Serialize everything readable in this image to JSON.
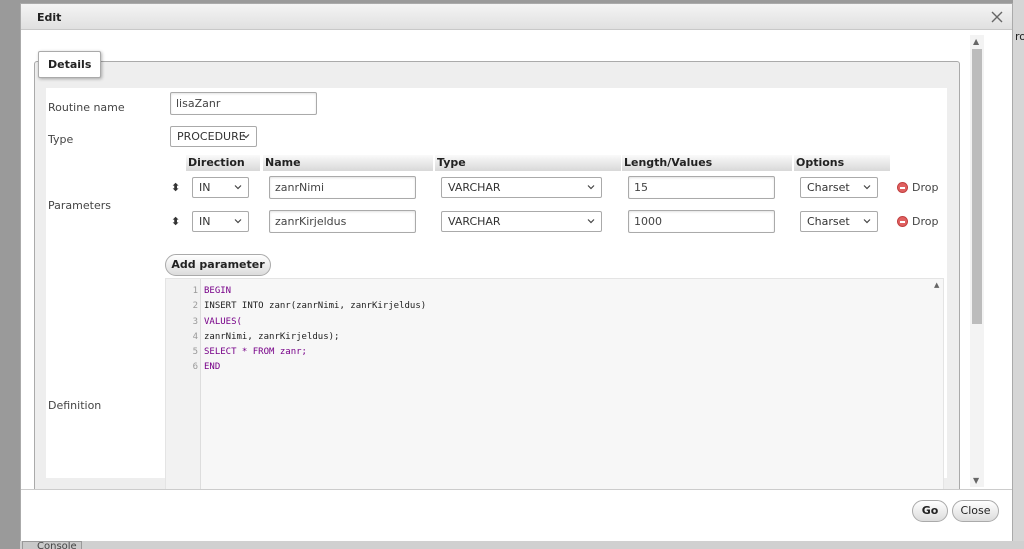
{
  "background": {
    "side_text": "ro",
    "console_tab": "Console"
  },
  "dialog": {
    "title": "Edit",
    "legend": "Details"
  },
  "form": {
    "routine_name_label": "Routine name",
    "routine_name_value": "lisaZanr",
    "type_label": "Type",
    "type_value": "PROCEDURE",
    "parameters_label": "Parameters",
    "definition_label": "Definition",
    "add_parameter_label": "Add parameter"
  },
  "params_table": {
    "headers": [
      "Direction",
      "Name",
      "Type",
      "Length/Values",
      "Options"
    ],
    "drop_label": "Drop",
    "rows": [
      {
        "direction": "IN",
        "name": "zanrNimi",
        "type": "VARCHAR",
        "length": "15",
        "options": "Charset"
      },
      {
        "direction": "IN",
        "name": "zanrKirjeldus",
        "type": "VARCHAR",
        "length": "1000",
        "options": "Charset"
      }
    ]
  },
  "code": {
    "lines": [
      {
        "n": "1",
        "text": "BEGIN"
      },
      {
        "n": "2",
        "text": "INSERT INTO zanr(zanrNimi, zanrKirjeldus)"
      },
      {
        "n": "3",
        "text": "VALUES("
      },
      {
        "n": "4",
        "text": "zanrNimi, zanrKirjeldus);"
      },
      {
        "n": "5",
        "text": "SELECT * FROM zanr;"
      },
      {
        "n": "6",
        "text": "END"
      }
    ]
  },
  "footer": {
    "go_label": "Go",
    "close_label": "Close"
  }
}
